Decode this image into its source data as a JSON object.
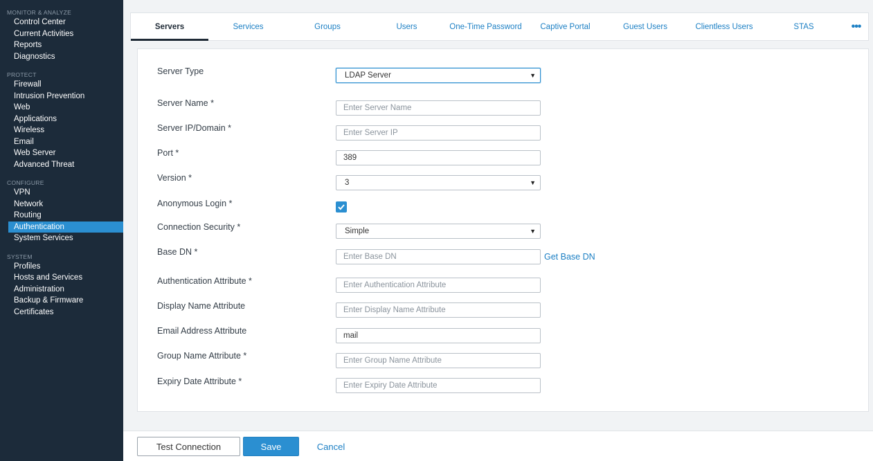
{
  "sidebar": {
    "sections": [
      {
        "heading": "MONITOR & ANALYZE",
        "items": [
          "Control Center",
          "Current Activities",
          "Reports",
          "Diagnostics"
        ]
      },
      {
        "heading": "PROTECT",
        "items": [
          "Firewall",
          "Intrusion Prevention",
          "Web",
          "Applications",
          "Wireless",
          "Email",
          "Web Server",
          "Advanced Threat"
        ]
      },
      {
        "heading": "CONFIGURE",
        "items": [
          "VPN",
          "Network",
          "Routing",
          "Authentication",
          "System Services"
        ]
      },
      {
        "heading": "SYSTEM",
        "items": [
          "Profiles",
          "Hosts and Services",
          "Administration",
          "Backup & Firmware",
          "Certificates"
        ]
      }
    ],
    "active_item": "Authentication"
  },
  "tabs": {
    "items": [
      "Servers",
      "Services",
      "Groups",
      "Users",
      "One-Time Password",
      "Captive Portal",
      "Guest Users",
      "Clientless Users",
      "STAS"
    ],
    "active": "Servers",
    "more_label": "•••"
  },
  "form": {
    "server_type": {
      "label": "Server Type",
      "value": "LDAP Server"
    },
    "server_name": {
      "label": "Server Name *",
      "placeholder": "Enter Server Name",
      "value": ""
    },
    "server_ip": {
      "label": "Server IP/Domain *",
      "placeholder": "Enter Server IP",
      "value": ""
    },
    "port": {
      "label": "Port *",
      "value": "389"
    },
    "version": {
      "label": "Version *",
      "value": "3"
    },
    "anonymous_login": {
      "label": "Anonymous Login *",
      "checked": true
    },
    "connection_security": {
      "label": "Connection Security *",
      "value": "Simple"
    },
    "base_dn": {
      "label": "Base DN *",
      "placeholder": "Enter Base DN",
      "value": "",
      "link": "Get Base DN"
    },
    "auth_attr": {
      "label": "Authentication Attribute *",
      "placeholder": "Enter Authentication Attribute",
      "value": ""
    },
    "display_name_attr": {
      "label": "Display Name Attribute",
      "placeholder": "Enter Display Name Attribute",
      "value": ""
    },
    "email_attr": {
      "label": "Email Address Attribute",
      "value": "mail"
    },
    "group_name_attr": {
      "label": "Group Name Attribute *",
      "placeholder": "Enter Group Name Attribute",
      "value": ""
    },
    "expiry_date_attr": {
      "label": "Expiry Date Attribute *",
      "placeholder": "Enter Expiry Date Attribute",
      "value": ""
    }
  },
  "footer": {
    "test_label": "Test Connection",
    "save_label": "Save",
    "cancel_label": "Cancel"
  },
  "icons": {
    "caret": "chevron-down-icon",
    "more": "more-horizontal-icon",
    "check": "check-icon"
  },
  "colors": {
    "sidebar_bg": "#1c2b3a",
    "accent": "#2b8fd1",
    "link": "#1b7fc4"
  }
}
